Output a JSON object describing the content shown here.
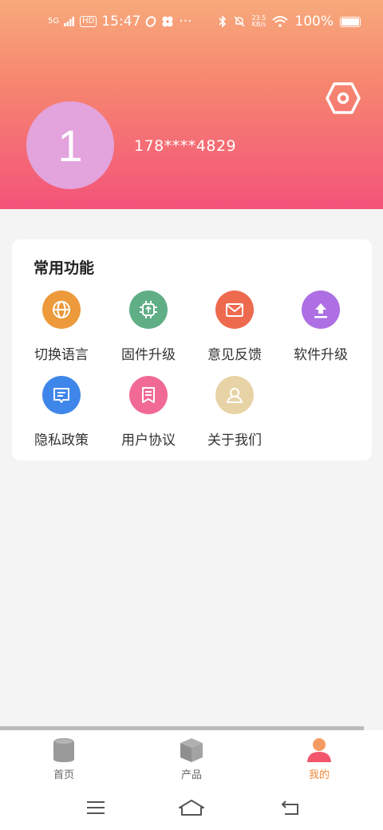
{
  "status_bar": {
    "network": "5G",
    "hd": "HD",
    "time": "15:47",
    "more": "···",
    "net_speed_value": "23.5",
    "net_speed_unit": "KB/s",
    "battery": "100%"
  },
  "profile": {
    "avatar_initial": "1",
    "phone": "178****4829"
  },
  "functions": {
    "title": "常用功能",
    "items": [
      {
        "label": "切换语言",
        "icon": "globe-icon",
        "color": "#ec9a3b"
      },
      {
        "label": "固件升级",
        "icon": "firmware-chip-icon",
        "color": "#5fae86"
      },
      {
        "label": "意见反馈",
        "icon": "mail-icon",
        "color": "#ee6a4f"
      },
      {
        "label": "软件升级",
        "icon": "upload-icon",
        "color": "#ad6fe3"
      },
      {
        "label": "隐私政策",
        "icon": "privacy-document-icon",
        "color": "#3f86ea"
      },
      {
        "label": "用户协议",
        "icon": "agreement-document-icon",
        "color": "#f06a95"
      },
      {
        "label": "关于我们",
        "icon": "about-user-icon",
        "color": "#e8d3a6"
      }
    ]
  },
  "tabbar": {
    "items": [
      {
        "label": "首页",
        "icon": "home-device-icon",
        "active": false
      },
      {
        "label": "产品",
        "icon": "product-box-icon",
        "active": false
      },
      {
        "label": "我的",
        "icon": "profile-person-icon",
        "active": true
      }
    ],
    "active_color": "#f08a3a"
  }
}
